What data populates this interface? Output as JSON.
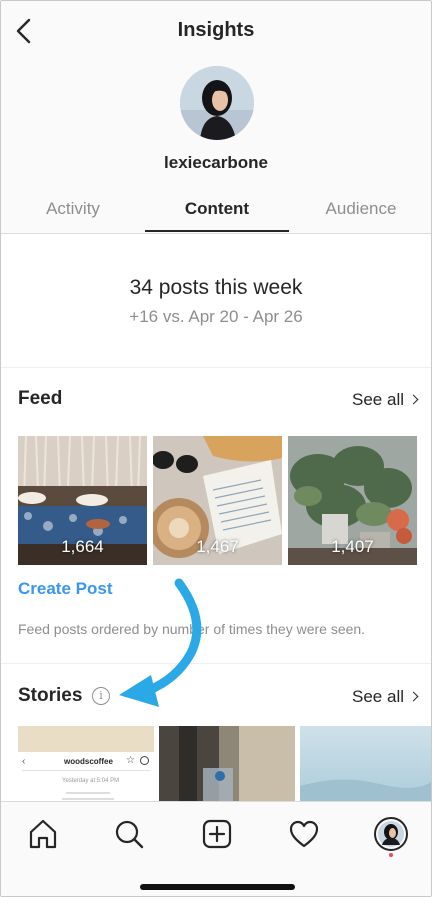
{
  "header": {
    "title": "Insights",
    "username": "lexiecarbone"
  },
  "tabs": [
    {
      "label": "Activity",
      "active": false
    },
    {
      "label": "Content",
      "active": true
    },
    {
      "label": "Audience",
      "active": false
    }
  ],
  "summary": {
    "posts": "34 posts this week",
    "comparison": "+16 vs. Apr 20 - Apr 26"
  },
  "feed": {
    "title": "Feed",
    "see_all": "See all",
    "posts": [
      {
        "count": "1,664"
      },
      {
        "count": "1,467"
      },
      {
        "count": "1,407"
      }
    ],
    "create_post": "Create Post",
    "note": "Feed posts ordered by number of times they were seen."
  },
  "stories": {
    "title": "Stories",
    "see_all": "See all",
    "info_glyph": "i",
    "story1_account": "woodscoffee",
    "story1_time": "Yesterday at 5:04 PM"
  },
  "colors": {
    "accent": "#3897f0",
    "annotation_arrow": "#2aa9e6",
    "notification_dot": "#ed4956"
  },
  "icons": [
    "back-arrow-icon",
    "info-icon",
    "chevron-right-icon",
    "home-icon",
    "search-icon",
    "new-post-icon",
    "heart-icon",
    "profile-avatar",
    "star-icon"
  ]
}
